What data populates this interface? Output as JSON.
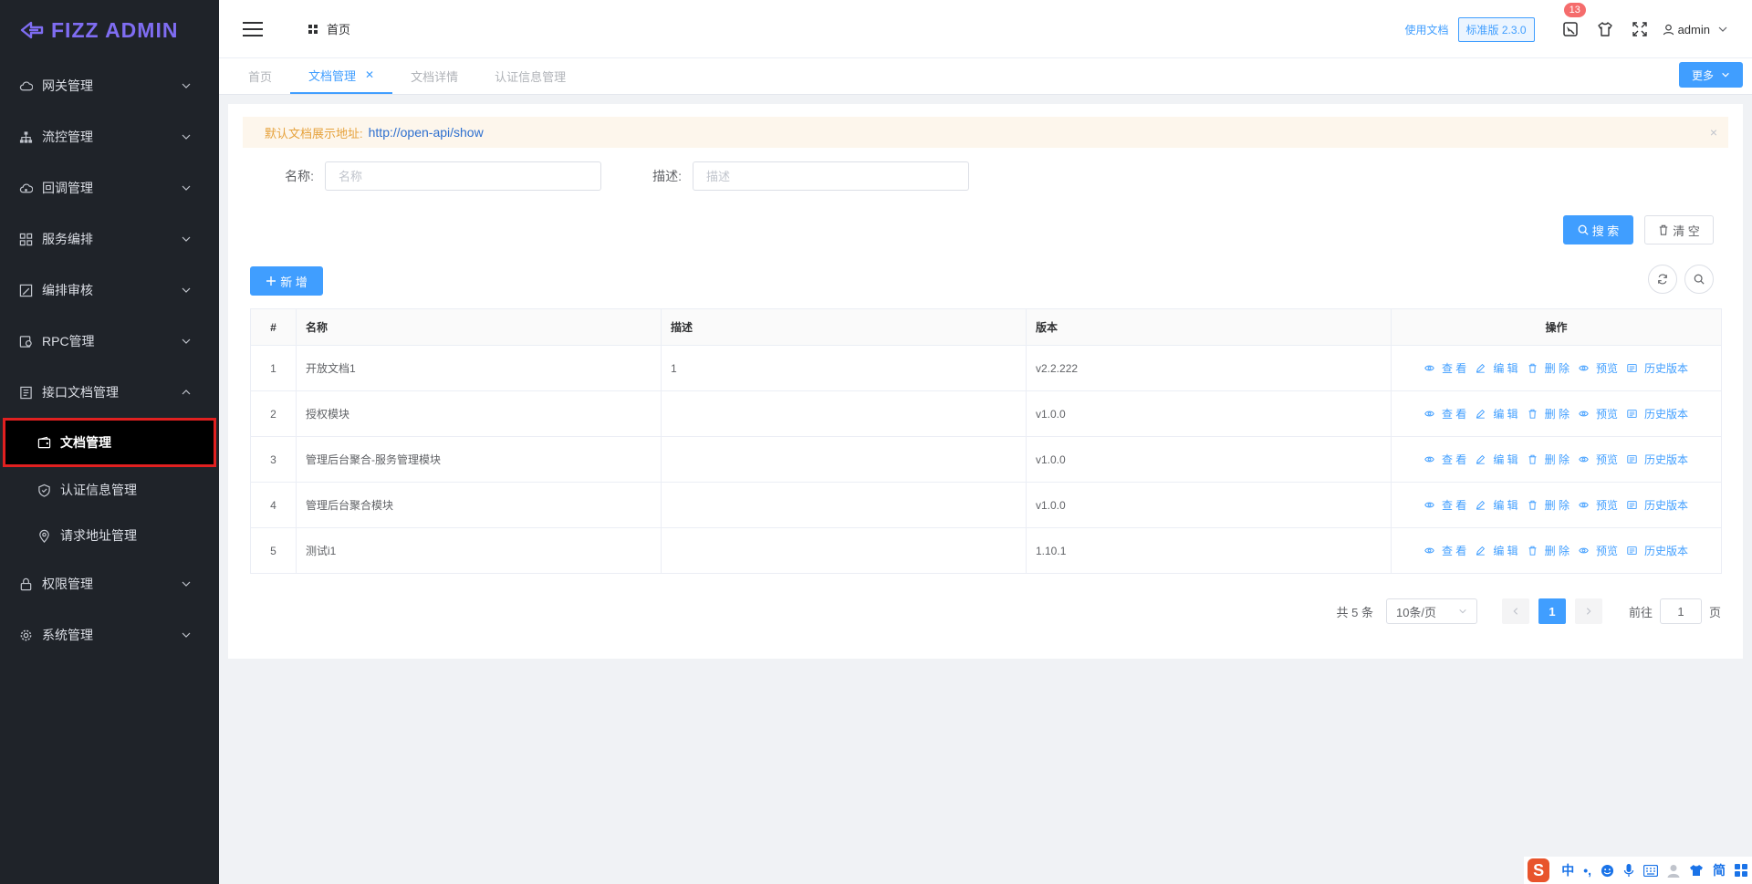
{
  "app": {
    "logo_text": "FIZZ ADMIN"
  },
  "sidebar": {
    "items": [
      {
        "label": "网关管理",
        "icon": "cloud-icon"
      },
      {
        "label": "流控管理",
        "icon": "hierarchy-icon"
      },
      {
        "label": "回调管理",
        "icon": "cloud-sync-icon"
      },
      {
        "label": "服务编排",
        "icon": "grid-icon"
      },
      {
        "label": "编排审核",
        "icon": "edit-square-icon"
      },
      {
        "label": "RPC管理",
        "icon": "rpc-icon"
      },
      {
        "label": "接口文档管理",
        "icon": "document-icon",
        "expanded": true
      },
      {
        "label": "权限管理",
        "icon": "lock-icon"
      },
      {
        "label": "系统管理",
        "icon": "gear-icon"
      }
    ],
    "sub_items": [
      {
        "label": "文档管理",
        "icon": "wallet-icon",
        "active": true
      },
      {
        "label": "认证信息管理",
        "icon": "shield-icon"
      },
      {
        "label": "请求地址管理",
        "icon": "location-icon"
      }
    ]
  },
  "header": {
    "breadcrumb": "首页",
    "docs_link": "使用文档",
    "version": "标准版 2.3.0",
    "notification_count": "13",
    "user": "admin"
  },
  "tabs": {
    "items": [
      {
        "label": "首页"
      },
      {
        "label": "文档管理",
        "active": true,
        "closable": true
      },
      {
        "label": "文档详情"
      },
      {
        "label": "认证信息管理"
      }
    ],
    "more_label": "更多"
  },
  "alert": {
    "text": "默认文档展示地址:",
    "link": "http://open-api/show",
    "close": "×"
  },
  "filters": {
    "name_label": "名称:",
    "name_placeholder": "名称",
    "desc_label": "描述:",
    "desc_placeholder": "描述"
  },
  "actions": {
    "search": "搜 索",
    "clear": "清 空",
    "add": "新 增"
  },
  "table": {
    "columns": [
      "#",
      "名称",
      "描述",
      "版本",
      "操作"
    ],
    "rows": [
      {
        "idx": "1",
        "name": "开放文档1",
        "desc": "1",
        "version": "v2.2.222"
      },
      {
        "idx": "2",
        "name": "授权模块",
        "desc": "",
        "version": "v1.0.0"
      },
      {
        "idx": "3",
        "name": "管理后台聚合-服务管理模块",
        "desc": "",
        "version": "v1.0.0"
      },
      {
        "idx": "4",
        "name": "管理后台聚合模块",
        "desc": "",
        "version": "v1.0.0"
      },
      {
        "idx": "5",
        "name": "测试i1",
        "desc": "",
        "version": "1.10.1"
      }
    ],
    "row_actions": {
      "view": "查 看",
      "edit": "编 辑",
      "delete": "删 除",
      "preview": "预览",
      "history": "历史版本"
    }
  },
  "pagination": {
    "total": "共 5 条",
    "page_size": "10条/页",
    "current_page": "1",
    "goto_label": "前往",
    "goto_value": "1",
    "page_suffix": "页"
  },
  "ime": {
    "logo": "S",
    "mode": "中",
    "punct": "•,",
    "simplified": "简"
  },
  "colors": {
    "primary": "#409eff",
    "sidebar_bg": "#1f2329",
    "logo": "#7f6df2",
    "alert_text": "#e6a23c",
    "badge": "#f56c6c"
  }
}
